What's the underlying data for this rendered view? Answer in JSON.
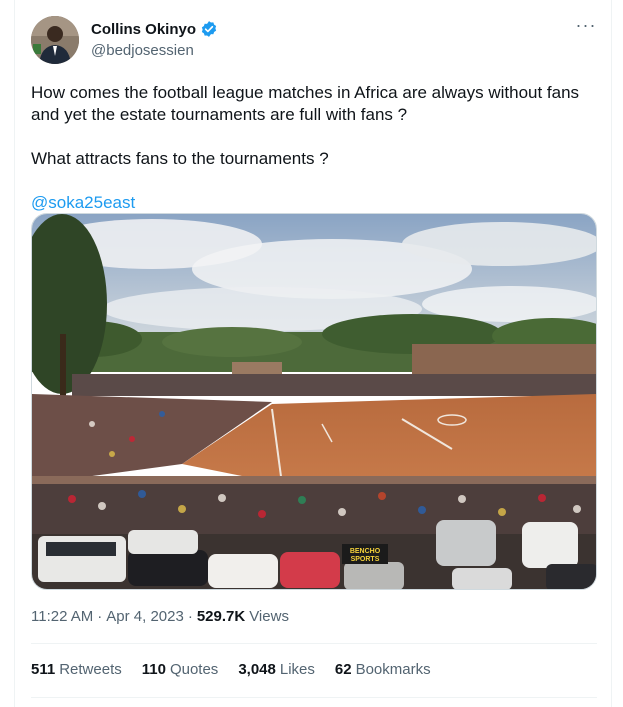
{
  "author": {
    "display_name": "Collins Okinyo",
    "handle": "@bedjosessien",
    "verified_color": "#1d9bf0"
  },
  "more_menu_glyph": "···",
  "tweet": {
    "paragraphs": [
      "How comes the football league matches in Africa are always without fans and yet the estate tournaments are full with fans  ?",
      "What attracts fans to the tournaments ?"
    ],
    "mention": "@soka25east"
  },
  "media": {
    "banner_text_1": "BENCHO",
    "banner_text_2": "SPORTS"
  },
  "meta": {
    "time": "11:22 AM",
    "separator": "·",
    "date": "Apr 4, 2023",
    "views_count": "529.7K",
    "views_label": "Views"
  },
  "stats": {
    "retweets": {
      "count": "511",
      "label": "Retweets"
    },
    "quotes": {
      "count": "110",
      "label": "Quotes"
    },
    "likes": {
      "count": "3,048",
      "label": "Likes"
    },
    "bookmarks": {
      "count": "62",
      "label": "Bookmarks"
    }
  },
  "colors": {
    "accent": "#1d9bf0",
    "secondary_text": "#536471",
    "primary_text": "#0f1419"
  }
}
